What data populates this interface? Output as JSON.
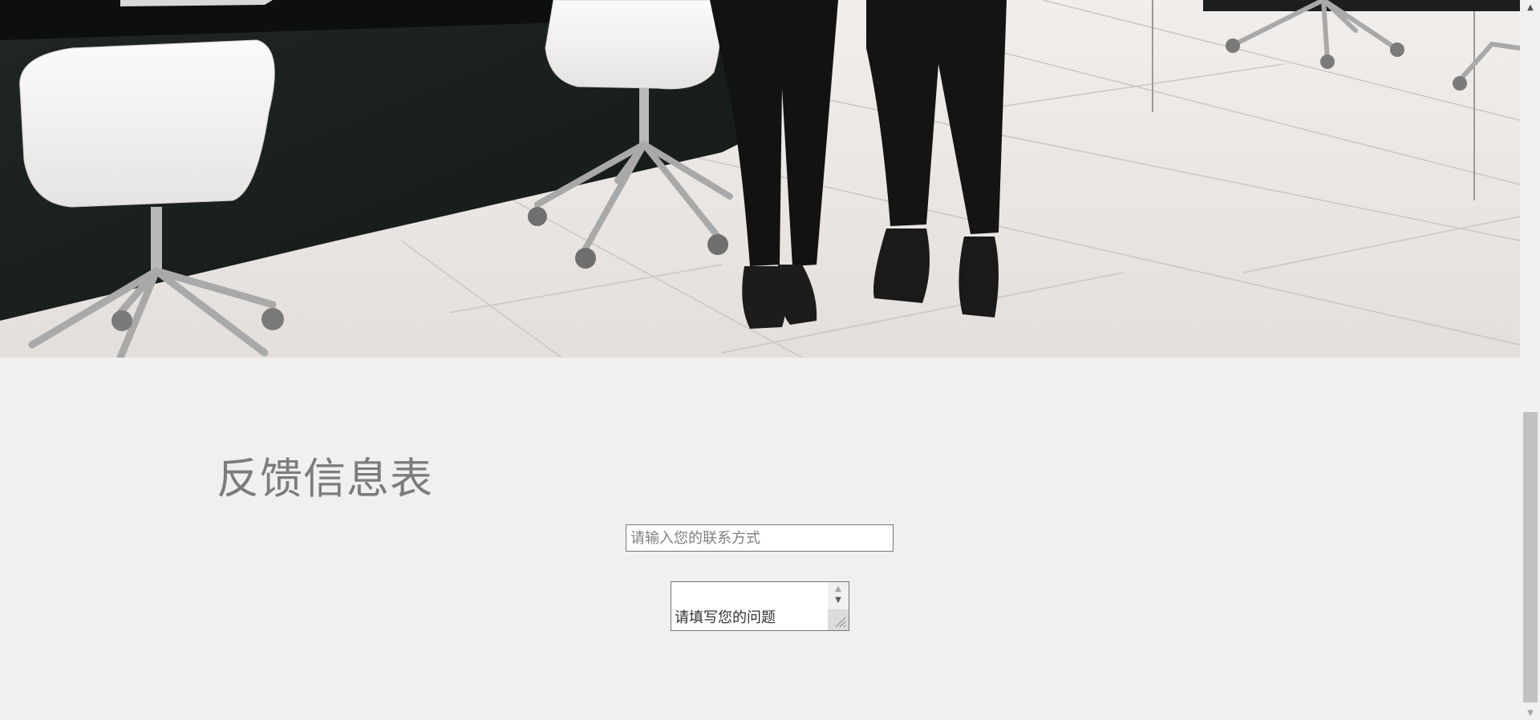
{
  "hero": {
    "image_name": "office-photo"
  },
  "feedback": {
    "title": "反馈信息表",
    "contact_placeholder": "请输入您的联系方式",
    "question_text": "请填写您的问题"
  },
  "icons": {
    "scroll_up": "▲",
    "scroll_down": "▼"
  },
  "colors": {
    "page_background": "#f0f0f0",
    "title_color": "#7c7c7c",
    "scrollbar_thumb": "#c1c1c1"
  }
}
